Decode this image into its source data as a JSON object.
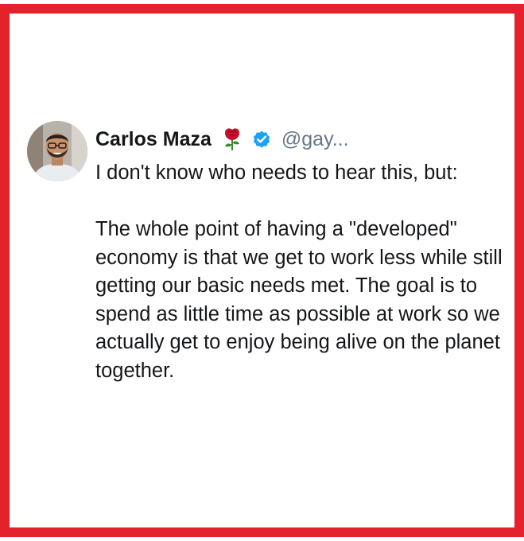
{
  "tweet": {
    "author_name": "Carlos Maza",
    "author_handle": "@gay...",
    "verified_icon": "verified-badge-icon",
    "name_emoji_icon": "rose-icon",
    "text": "I don't know who needs to hear this, but:\n\nThe whole point of having a \"developed\" economy is that we get to work less while still getting our basic needs met. The goal is to spend as little time as possible at work so we actually get to enjoy being alive on the planet together."
  },
  "colors": {
    "frame_border": "#e3222b",
    "verified_blue": "#1da1f2",
    "text_primary": "#14171a",
    "text_secondary": "#657786"
  }
}
